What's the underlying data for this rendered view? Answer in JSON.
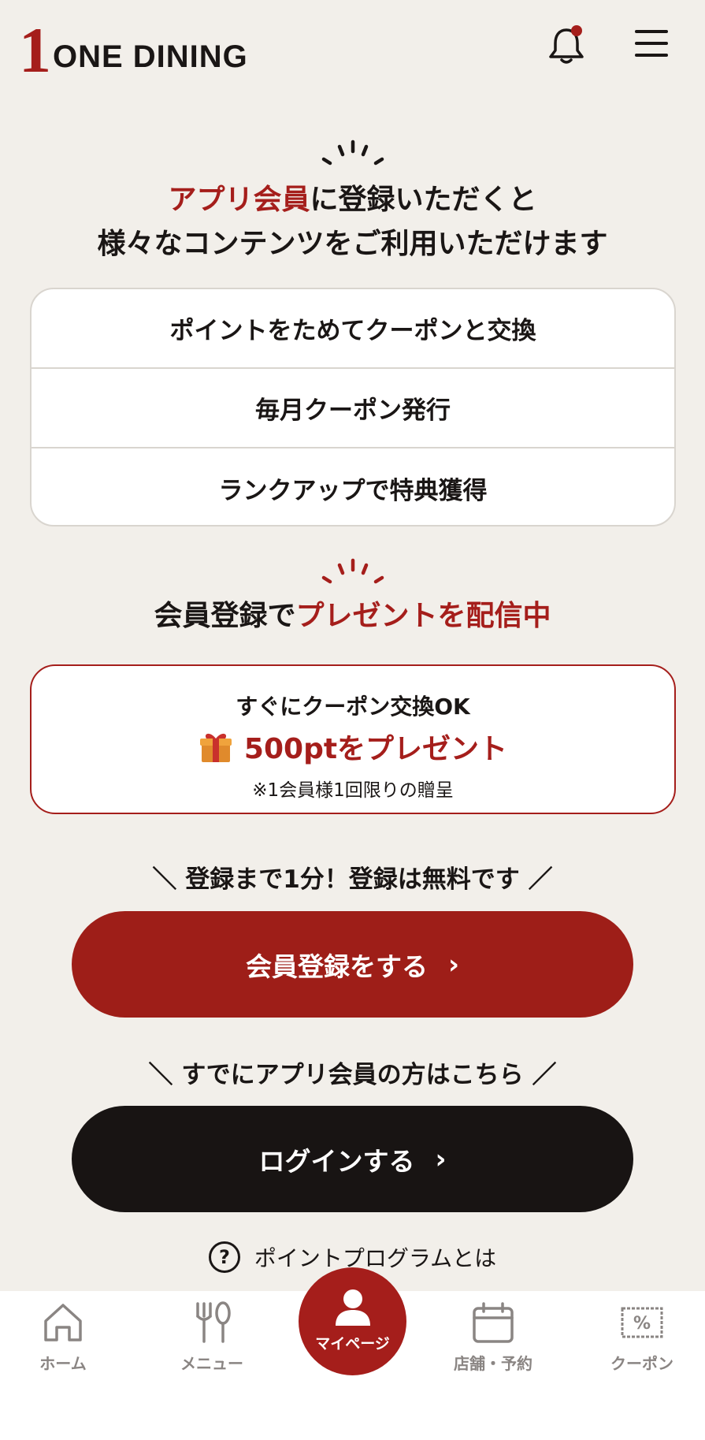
{
  "brand": {
    "logo_mark": "1",
    "logo_text": "ONE DINING"
  },
  "header": {
    "bell_icon": "bell-icon",
    "menu_icon": "hamburger-menu-icon",
    "notification_color": "#a51e1b"
  },
  "intro": {
    "accent_text": "アプリ会員",
    "line1_rest": "に登録いただくと",
    "line2": "様々なコンテンツをご利用いただけます"
  },
  "features": [
    "ポイントをためてクーポンと交換",
    "毎月クーポン発行",
    "ランクアップで特典獲得"
  ],
  "present": {
    "heading_prefix": "会員登録で",
    "heading_accent": "プレゼントを配信中",
    "line1": "すぐにクーポン交換OK",
    "line2": "500ptをプレゼント",
    "note": "※1会員様1回限りの贈呈",
    "icon": "gift-icon"
  },
  "register": {
    "lead": "＼ 登録まで1分！登録は無料です ／",
    "button": "会員登録をする",
    "chevron": "›"
  },
  "login": {
    "lead": "＼ すでにアプリ会員の方はこちら ／",
    "button": "ログインする",
    "chevron": "›"
  },
  "help": {
    "icon_text": "?",
    "label": "ポイントプログラムとは"
  },
  "tabs": {
    "home": "ホーム",
    "menu": "メニュー",
    "mypage": "マイページ",
    "stores": "店舗・予約",
    "coupon": "クーポン"
  },
  "colors": {
    "accent": "#a51e1b",
    "background": "#f2efea",
    "dark": "#181413"
  }
}
